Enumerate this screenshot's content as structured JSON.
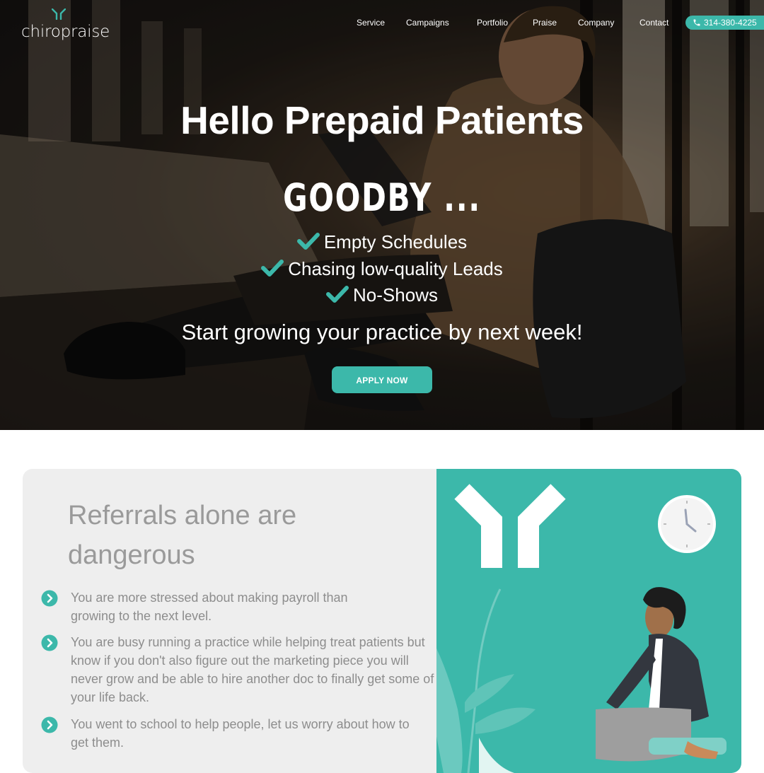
{
  "brand": {
    "name": "chiropraise"
  },
  "nav": {
    "items": [
      "Service",
      "Campaigns",
      "Portfolio",
      "Praise",
      "Company",
      "Contact"
    ],
    "phone": "314-380-4225"
  },
  "hero": {
    "title": "Hello Prepaid Patients",
    "goodbye": "GOODBY ...",
    "checks": [
      "Empty Schedules",
      "Chasing low-quality Leads",
      "No-Shows"
    ],
    "tagline": "Start growing your practice by next week!",
    "cta": "APPLY NOW"
  },
  "section": {
    "title_line1": "Referrals alone are",
    "title_line2": "dangerous",
    "bullets": [
      "You are more stressed about making payroll than growing to the next level.",
      "You are busy running a practice while helping treat patients but know if you don't also figure out the marketing piece you will never grow and be able to hire another doc to finally get some of your life back.",
      "You went to school to help people, let us worry about how to get them."
    ]
  },
  "colors": {
    "accent": "#3cb8aa",
    "card_bg": "#eeeeee",
    "text_muted": "#8d8d8d"
  },
  "icons": [
    "logo-y-icon",
    "phone-icon",
    "checkmark-icon",
    "chevron-circle-icon",
    "clock-icon"
  ]
}
